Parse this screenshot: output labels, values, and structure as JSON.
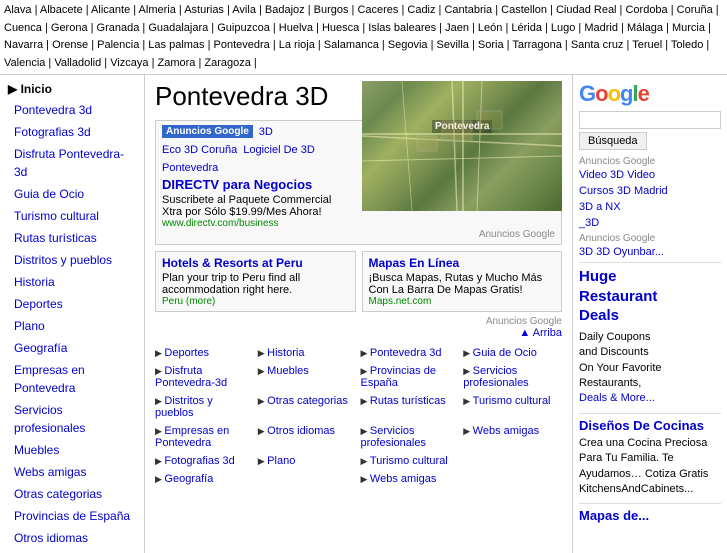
{
  "topnav": {
    "cities": [
      "Alava",
      "Albacete",
      "Alicante",
      "Almeria",
      "Asturias",
      "Avila",
      "Badajoz",
      "Burgos",
      "Caceres",
      "Cadiz",
      "Cantabria",
      "Castellon",
      "Ciudad Real",
      "Cordoba",
      "Coruña",
      "Cuenca",
      "Gerona",
      "Granada",
      "Guadalajara",
      "Guipuzcoa",
      "Huelva",
      "Huesca",
      "Islas baleares",
      "Jaen",
      "León",
      "Lérida",
      "Lugo",
      "Madrid",
      "Málaga",
      "Murcia",
      "Navarra",
      "Orense",
      "Palencia",
      "Las palmas",
      "Pontevedra",
      "La rioja",
      "Salamanca",
      "Segovia",
      "Sevilla",
      "Soria",
      "Tarragona",
      "Santa cruz",
      "Teruel",
      "Toledo",
      "Valencia",
      "Valladolid",
      "Vizcaya",
      "Zamora",
      "Zaragoza"
    ]
  },
  "sidebar": {
    "inicio_label": "▶ Inicio",
    "items": [
      "Pontevedra 3d",
      "Fotografias 3d",
      "Disfruta Pontevedra-3d",
      "Guia de Ocio",
      "Turismo cultural",
      "Rutas turísticas",
      "Distritos y pueblos",
      "Historia",
      "Deportes",
      "Plano",
      "Geografía",
      "Empresas en Pontevedra",
      "Servicios profesionales",
      "Muebles",
      "Webs amigas",
      "Otras categorias",
      "Provincias de España",
      "Otros idiomas"
    ]
  },
  "main": {
    "page_title": "Pontevedra 3D",
    "satellite_label": "Pontevedra",
    "ads_banner": {
      "ads_label": "Anuncios Google",
      "link1": "3D",
      "link2": "Eco 3D Coruña",
      "link3": "Logiciel De 3D",
      "link4": "Pontevedra",
      "main_ad_title": "DIRECTV para Negocios",
      "main_ad_desc": "Suscribete al Paquete Commercial Xtra por Sólo $19.99/Mes Ahora!",
      "main_ad_url": "www.directv.com/business",
      "google_label": "Anuncios Google"
    },
    "ads_two_col": [
      {
        "title": "Hotels & Resorts at Peru",
        "desc": "Plan your trip to Peru find all accommodation right here.",
        "url": "Peru (more)"
      },
      {
        "title": "Mapas En Línea",
        "desc": "¡Busca Mapas, Rutas y Mucho Más Con La Barra De Mapas Gratis!",
        "url": "Maps.net.com"
      }
    ],
    "ads_label2": "Anuncios Google",
    "arriba_label": "▲ Arriba",
    "link_grid": [
      [
        "Deportes",
        "Historia",
        "Pontevedra 3d",
        ""
      ],
      [
        "Disfruta Pontevedra-3d",
        "Muebles",
        "Provincias de España",
        ""
      ],
      [
        "Distritos y pueblos",
        "Otras categorias",
        "Rutas turísticas",
        ""
      ],
      [
        "Empresas en Pontevedra",
        "Otros idiomas",
        "Servicios profesionales",
        ""
      ],
      [
        "Fotografias 3d",
        "Plano",
        "Turismo cultural",
        ""
      ],
      [
        "Geografía",
        "",
        "Webs amigas",
        ""
      ]
    ],
    "link_grid_flat": [
      "Deportes",
      "Historia",
      "Pontevedra 3d",
      "",
      "Disfruta Pontevedra-3d",
      "Muebles",
      "Provincias de España",
      "",
      "Distritos y pueblos",
      "Otras categorias",
      "Rutas turísticas",
      "",
      "Empresas en Pontevedra",
      "Otros idiomas",
      "Servicios profesionales",
      "",
      "Fotografias 3d",
      "Plano",
      "Turismo cultural",
      "",
      "Geografía",
      "",
      "Webs amigas",
      ""
    ]
  },
  "right": {
    "google_logo": "Google",
    "search_placeholder": "",
    "search_button": "Búsqueda",
    "ads_label": "Anuncios Google",
    "ads_items": [
      "Video 3D Video",
      "Cursos 3D Madrid",
      "3D a NX",
      "_3D"
    ],
    "ads_label2": "Anuncios Google",
    "ads_item2": "3D 3D Oyunbar...",
    "promo1_title": "Huge Restaurant Deals",
    "promo1_text1": "Daily Coupons",
    "promo1_text2": "and Discounts",
    "promo1_text3": "On Your Favorite Restaurants,",
    "promo1_text4": "Deals & More...",
    "promo2_title": "Diseños De Cocinas",
    "promo2_text": "Crea una Cocina Preciosa Para Tu Familia. Te Ayudamos… Cotiza Gratis KitchensAndCabinets...",
    "mapas_label": "Mapas de..."
  }
}
